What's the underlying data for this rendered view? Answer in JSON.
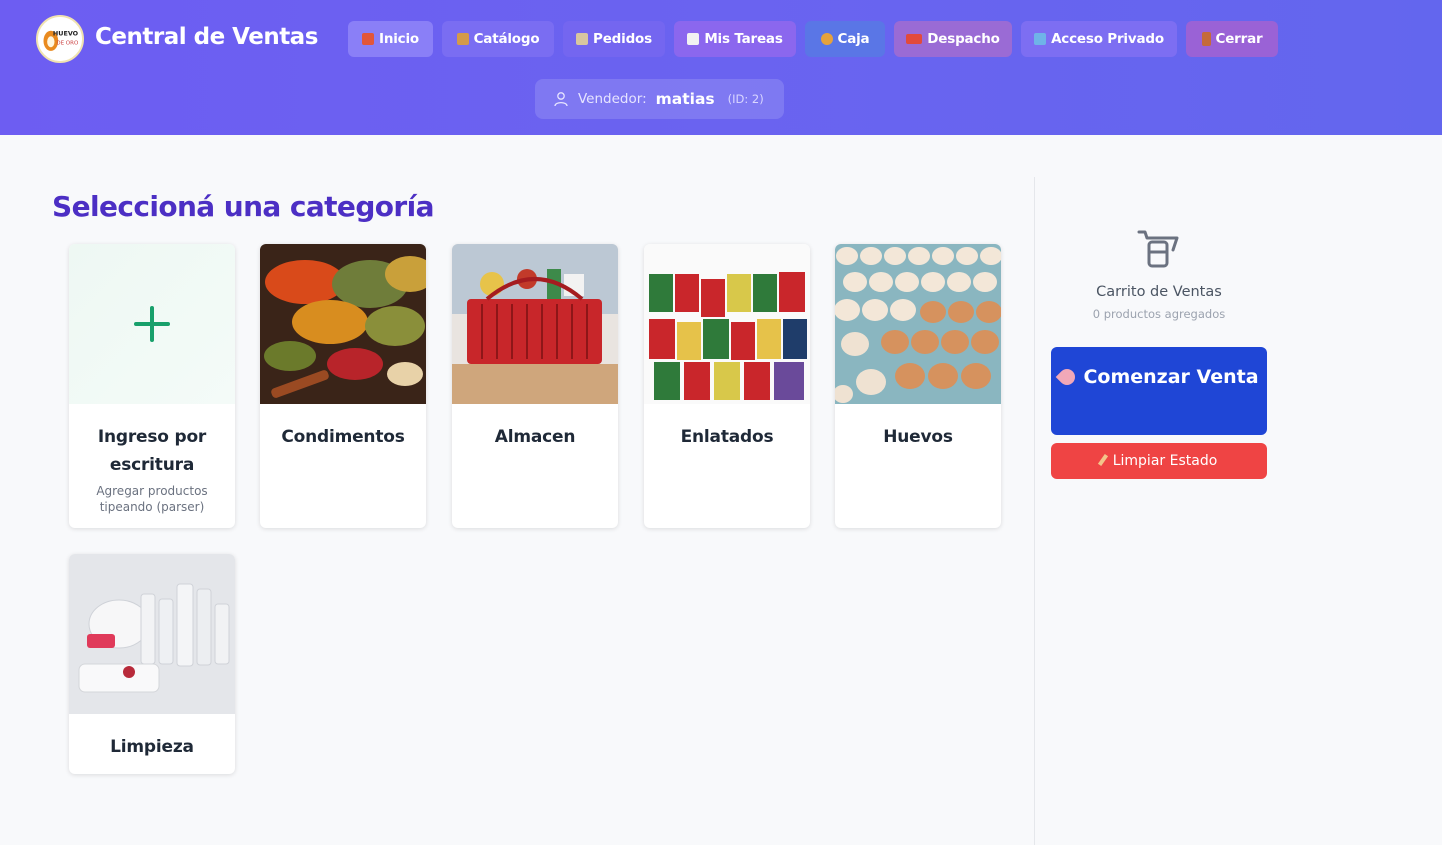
{
  "header": {
    "brand": "Central de Ventas",
    "logo_text": [
      "HUEVO",
      "DE ORO"
    ],
    "nav": [
      {
        "label": "Inicio",
        "icon": "house-icon",
        "color": "#e2563a"
      },
      {
        "label": "Catálogo",
        "icon": "box-icon",
        "color": "#d49a4a"
      },
      {
        "label": "Pedidos",
        "icon": "clipboard-icon",
        "color": "#d8c6a0"
      },
      {
        "label": "Mis Tareas",
        "icon": "memo-icon",
        "color": "#f2f2f2"
      },
      {
        "label": "Caja",
        "icon": "money-bag-icon",
        "color": "#e6a23c"
      },
      {
        "label": "Despacho",
        "icon": "truck-icon",
        "color": "#e24a3b"
      },
      {
        "label": "Acceso Privado",
        "icon": "bar-chart-icon",
        "color": "#6fb3e8"
      },
      {
        "label": "Cerrar",
        "icon": "door-icon",
        "color": "#c56a3a"
      }
    ],
    "vendor": {
      "label": "Vendedor:",
      "name": "matias",
      "id": "(ID: 2)"
    }
  },
  "main": {
    "title": "Seleccioná una categoría",
    "categories": [
      {
        "name": "Ingreso por escritura",
        "subtitle": "Agregar productos tipeando (parser)",
        "icon": "plus-icon"
      },
      {
        "name": "Condimentos",
        "image": "spices-photo"
      },
      {
        "name": "Almacen",
        "image": "grocery-basket-photo"
      },
      {
        "name": "Enlatados",
        "image": "canned-goods-photo"
      },
      {
        "name": "Huevos",
        "image": "eggs-photo"
      },
      {
        "name": "Limpieza",
        "image": "cleaning-supplies-photo"
      }
    ]
  },
  "sidebar": {
    "cart_title": "Carrito de Ventas",
    "cart_count": "0 productos agregados",
    "start_button": "Comenzar Venta",
    "start_icon": "rocket-icon",
    "clear_button": "Limpiar Estado",
    "clear_icon": "broom-icon"
  },
  "colors": {
    "header": "#6a63f0",
    "title": "#4c2fc4",
    "start": "#1f46d6",
    "clear": "#ef4444",
    "plus": "#18a06b"
  }
}
